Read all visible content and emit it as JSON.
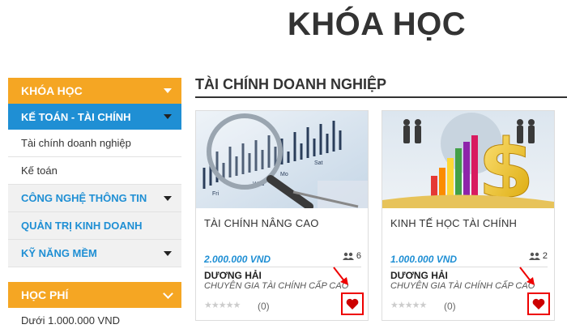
{
  "page": {
    "title": "KHÓA HỌC"
  },
  "sidebar": {
    "header": "KHÓA HỌC",
    "active_category": "KẾ TOÁN - TÀI CHÍNH",
    "subitems": [
      "Tài chính doanh nghiệp",
      "Kế toán"
    ],
    "categories": [
      "CÔNG NGHỆ THÔNG TIN",
      "QUẢN TRỊ KINH DOANH",
      "KỸ NĂNG MỀM"
    ],
    "fee_header": "HỌC PHÍ",
    "fee_items": [
      "Dưới 1.000.000 VND"
    ]
  },
  "section": {
    "title": "TÀI CHÍNH DOANH NGHIỆP"
  },
  "courses": [
    {
      "name": "TÀI CHÍNH NÂNG CAO",
      "price": "2.000.000 VND",
      "students": "6",
      "teacher": "DƯƠNG HẢI",
      "teacher_title": "CHUYÊN GIA TÀI CHÍNH CẤP CAO",
      "rating_count": "(0)",
      "chart_labels": [
        "Fri",
        "Wed",
        "Mo",
        "Sat"
      ]
    },
    {
      "name": "KINH TẾ HỌC TÀI CHÍNH",
      "price": "1.000.000 VND",
      "students": "2",
      "teacher": "DƯƠNG HẢI",
      "teacher_title": "CHUYÊN GIA TÀI CHÍNH CẤP CAO",
      "rating_count": "(0)"
    }
  ],
  "colors": {
    "accent_orange": "#f5a623",
    "accent_blue": "#1f8fd4",
    "heart_red": "#e00000"
  },
  "icons": [
    "caret-down-icon",
    "chevron-down-icon",
    "users-icon",
    "star-icon",
    "heart-icon",
    "arrow-annotation-icon"
  ]
}
